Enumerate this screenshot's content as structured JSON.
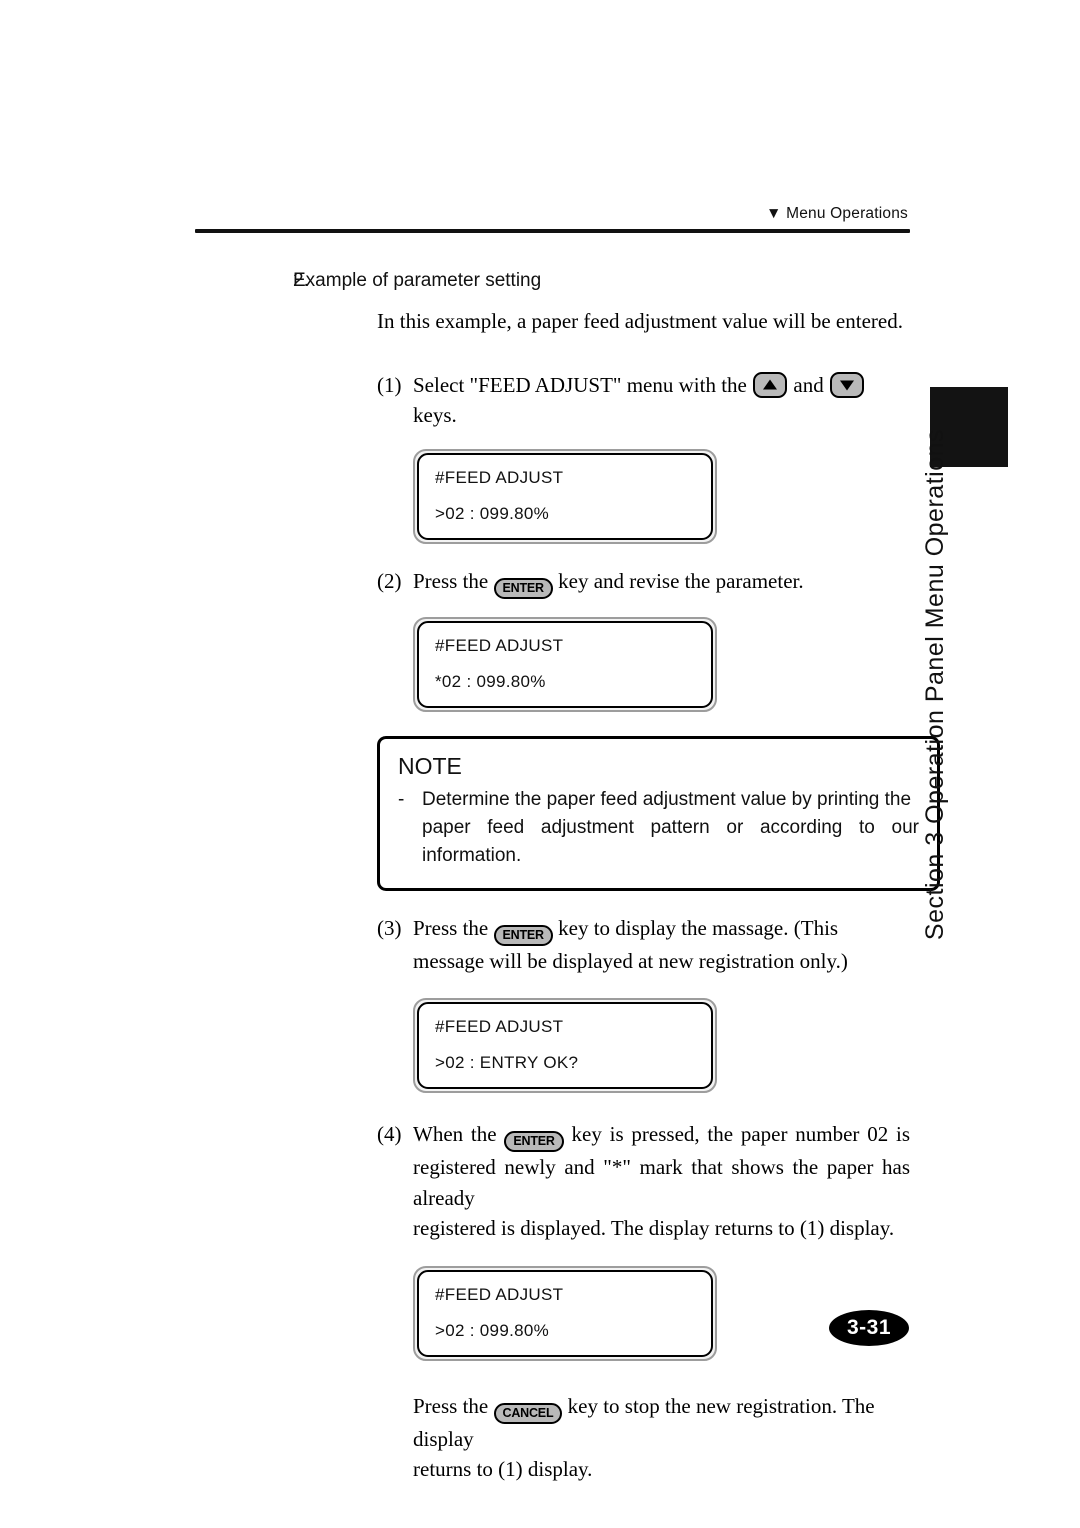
{
  "header": {
    "marker": "▼",
    "title": "Menu Operations"
  },
  "step": {
    "number": "2.",
    "title": "Example of parameter setting",
    "lead": "In this example, a paper feed adjustment value will be entered."
  },
  "steps": [
    {
      "marker": "(1)",
      "text_before": "Select \"FEED ADJUST\" menu with the",
      "text_middle": "and",
      "text_after": "keys.",
      "keys": [
        "up-arrow-key",
        "down-arrow-key"
      ]
    },
    {
      "marker": "(2)",
      "text_before": "Press the",
      "key_label": "ENTER",
      "text_after": "key and revise the parameter."
    },
    {
      "marker": "(3)",
      "text_before": "Press the",
      "key_label": "ENTER",
      "text_after": "key to display the massage.",
      "line2": "(This message will be displayed at new registration only.)"
    },
    {
      "marker": "(4)",
      "text_before": "When the",
      "key_label": "ENTER",
      "line1_after": "key is pressed, the paper number 02 is",
      "line2": "registered newly and \"*\" mark that shows the paper has already",
      "line3": "registered is displayed.  The display returns to (1) display."
    }
  ],
  "lcd_displays": [
    {
      "name": "lcd-display-1",
      "line1": "#FEED ADJUST",
      "line2": ">02 : 099.80%"
    },
    {
      "name": "lcd-display-2",
      "line1": "#FEED ADJUST",
      "line2": "*02 : 099.80%"
    },
    {
      "name": "lcd-display-3",
      "line1": "#FEED ADJUST",
      "line2": ">02 : ENTRY OK?"
    },
    {
      "name": "lcd-display-4",
      "line1": "#FEED ADJUST",
      "line2": ">02 : 099.80%"
    }
  ],
  "note": {
    "title": "NOTE",
    "dash": "-",
    "line1": "Determine the paper feed adjustment value by printing the",
    "line2": "paper feed adjustment pattern or according to our",
    "line3": "information."
  },
  "closing": {
    "text_before": "Press the",
    "key_label": "CANCEL",
    "line1_after": "key to stop the new registration.  The display",
    "line2": "returns to (1) display."
  },
  "side_tab": {
    "text": "Section 3  Operation Panel Menu Operations"
  },
  "page_number": "3-31"
}
